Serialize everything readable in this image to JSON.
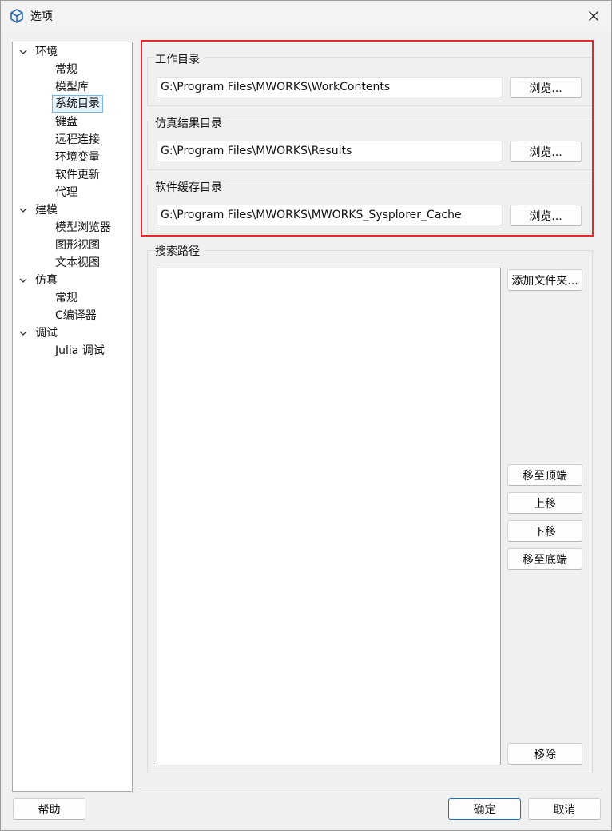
{
  "window": {
    "title": "选项",
    "close_symbol": "✕"
  },
  "tree": {
    "groups": [
      {
        "label": "环境",
        "items": [
          "常规",
          "模型库",
          "系统目录",
          "键盘",
          "远程连接",
          "环境变量",
          "软件更新",
          "代理"
        ]
      },
      {
        "label": "建模",
        "items": [
          "模型浏览器",
          "图形视图",
          "文本视图"
        ]
      },
      {
        "label": "仿真",
        "items": [
          "常规",
          "C编译器"
        ]
      },
      {
        "label": "调试",
        "items": [
          "Julia 调试"
        ]
      }
    ],
    "selected": "系统目录"
  },
  "directories": {
    "work": {
      "title": "工作目录",
      "value": "G:\\Program Files\\MWORKS\\WorkContents",
      "browse": "浏览..."
    },
    "results": {
      "title": "仿真结果目录",
      "value": "G:\\Program Files\\MWORKS\\Results",
      "browse": "浏览..."
    },
    "cache": {
      "title": "软件缓存目录",
      "value": "G:\\Program Files\\MWORKS\\MWORKS_Sysplorer_Cache",
      "browse": "浏览..."
    }
  },
  "search_path": {
    "title": "搜索路径",
    "add_folder": "添加文件夹...",
    "move_top": "移至顶端",
    "move_up": "上移",
    "move_down": "下移",
    "move_bottom": "移至底端",
    "remove": "移除"
  },
  "footer": {
    "help": "帮助",
    "ok": "确定",
    "cancel": "取消"
  },
  "colors": {
    "highlight": "#e8272c",
    "selection": "#e5f1fb",
    "primary_border": "#1f6fbf"
  }
}
